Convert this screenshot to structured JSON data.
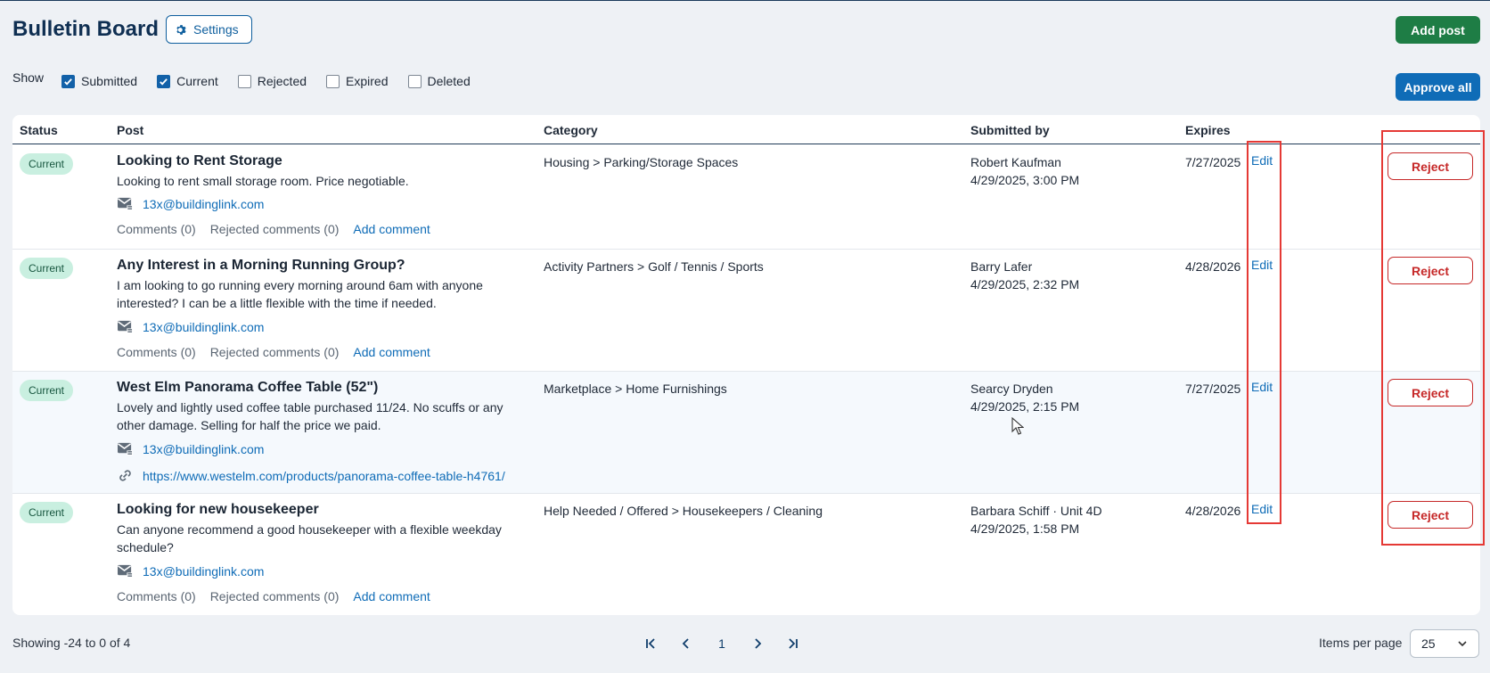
{
  "header": {
    "title": "Bulletin Board",
    "settings_label": "Settings",
    "add_post_label": "Add post",
    "approve_all_label": "Approve all"
  },
  "filters": {
    "show_label": "Show",
    "items": [
      {
        "label": "Submitted",
        "checked": true
      },
      {
        "label": "Current",
        "checked": true
      },
      {
        "label": "Rejected",
        "checked": false
      },
      {
        "label": "Expired",
        "checked": false
      },
      {
        "label": "Deleted",
        "checked": false
      }
    ]
  },
  "table": {
    "columns": [
      "Status",
      "Post",
      "Category",
      "Submitted by",
      "Expires"
    ],
    "edit_label": "Edit",
    "reject_label": "Reject",
    "comments_label": "Comments (0)",
    "rejected_comments_label": "Rejected comments (0)",
    "add_comment_label": "Add comment",
    "rows": [
      {
        "status": "Current",
        "title": "Looking to Rent Storage",
        "body": "Looking to rent small storage room. Price negotiable.",
        "email": "13x@buildinglink.com",
        "category": "Housing > Parking/Storage Spaces",
        "submitted_by": "Robert Kaufman",
        "submitted_at": "4/29/2025, 3:00 PM",
        "expires": "7/27/2025"
      },
      {
        "status": "Current",
        "title": "Any Interest in a Morning Running Group?",
        "body": "I am looking to go running every morning around 6am with anyone interested? I can be a little flexible with the time if needed.",
        "email": "13x@buildinglink.com",
        "category": "Activity Partners > Golf / Tennis / Sports",
        "submitted_by": "Barry Lafer",
        "submitted_at": "4/29/2025, 2:32 PM",
        "expires": "4/28/2026"
      },
      {
        "status": "Current",
        "title": "West Elm Panorama Coffee Table (52\")",
        "body": "Lovely and lightly used coffee table purchased 11/24. No scuffs or any other damage. Selling for half the price we paid.",
        "email": "13x@buildinglink.com",
        "link": "https://www.westelm.com/products/panorama-coffee-table-h4761/",
        "category": "Marketplace > Home Furnishings",
        "submitted_by": "Searcy Dryden",
        "submitted_at": "4/29/2025, 2:15 PM",
        "expires": "7/27/2025"
      },
      {
        "status": "Current",
        "title": "Looking for new housekeeper",
        "body": "Can anyone recommend a good housekeeper with a flexible weekday schedule?",
        "email": "13x@buildinglink.com",
        "category": "Help Needed / Offered > Housekeepers / Cleaning",
        "submitted_by": "Barbara Schiff · Unit 4D",
        "submitted_at": "4/29/2025, 1:58 PM",
        "expires": "4/28/2026"
      }
    ]
  },
  "footer": {
    "showing": "Showing -24 to 0 of 4",
    "page": "1",
    "items_per_page_label": "Items per page",
    "items_per_page_value": "25"
  },
  "colors": {
    "accent": "#0f6cb7",
    "add_post": "#1e7d45",
    "reject": "#c62828",
    "badge_bg": "#c9efe0",
    "highlight": "#e53935"
  },
  "icons": [
    "gear-icon",
    "checkbox-icon",
    "mail-icon",
    "link-icon",
    "first-page-icon",
    "prev-page-icon",
    "next-page-icon",
    "last-page-icon",
    "chevron-down-icon",
    "cursor-icon"
  ]
}
